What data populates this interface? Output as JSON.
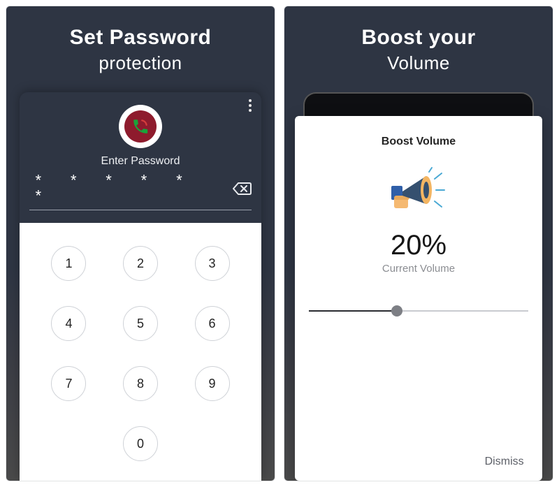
{
  "left": {
    "headline": "Set Password",
    "subhead": "protection",
    "enter_label": "Enter Password",
    "password_mask": "* * * * * *",
    "keys": [
      "1",
      "2",
      "3",
      "4",
      "5",
      "6",
      "7",
      "8",
      "9",
      "",
      "0",
      ""
    ]
  },
  "right": {
    "headline": "Boost your",
    "subhead": "Volume",
    "card_title": "Boost Volume",
    "percent": "20%",
    "current_label": "Current Volume",
    "slider_percent": 40,
    "dismiss": "Dismiss"
  },
  "colors": {
    "panel_bg": "#2e3543",
    "badge_inner": "#8e1b2d"
  }
}
